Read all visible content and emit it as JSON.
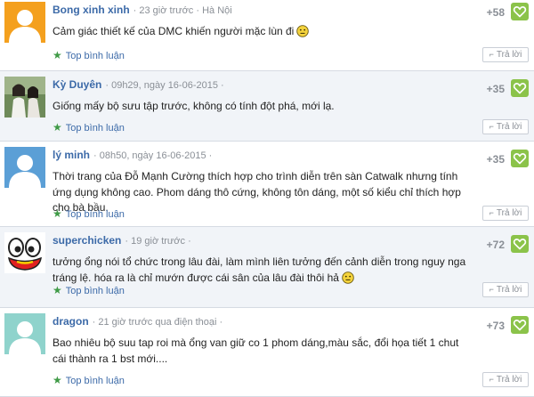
{
  "comments": [
    {
      "user": "Bong xinh xinh",
      "time": "· 23 giờ trước · Hà Nội",
      "text": "Cảm giác thiết kế của DMC khiến người mặc lùn đi",
      "emoticon": "neutral-face-icon",
      "score": "+58",
      "top_label": "Top bình luận",
      "reply_label": "Trả lời",
      "avatar": "default-avatar-orange"
    },
    {
      "user": "Kỳ Duyên",
      "time": "· 09h29, ngày 16-06-2015 ·",
      "text": "Giống mấy bộ sưu tập trước, không có tính đột phá, mới lạ.",
      "score": "+35",
      "top_label": "Top bình luận",
      "reply_label": "Trả lời",
      "avatar": "photo-avatar"
    },
    {
      "user": "lý minh",
      "time": "· 08h50, ngày 16-06-2015 ·",
      "text": "Thời trang của Đỗ Mạnh Cường thích hợp cho trình diễn trên sàn Catwalk nhưng tính ứng dụng không cao. Phom dáng thô cứng, không tôn dáng, một số kiểu chỉ thích hợp cho bà bầu.",
      "score": "+35",
      "top_label": "Top bình luận",
      "reply_label": "Trả lời",
      "avatar": "default-avatar-blue"
    },
    {
      "user": "superchicken",
      "time": "· 19 giờ trước ·",
      "text": "tưởng ổng nói tổ chức trong lâu đài, làm mình liên tưởng đến cảnh diễn trong nguy nga tráng lệ. hóa ra là chỉ mướn được cái sân của lâu đài thôi hả",
      "emoticon": "neutral-face-icon",
      "score": "+72",
      "top_label": "Top bình luận",
      "reply_label": "Trả lời",
      "avatar": "cartoon-eyes-avatar"
    },
    {
      "user": "dragon",
      "time": "· 21 giờ trước qua điện thoại ·",
      "text": "Bao nhiêu bộ suu tap roi mà ổng van giữ co 1 phom dáng,màu sắc, đổi họa tiết 1 chut cái thành ra 1 bst mới....",
      "score": "+73",
      "top_label": "Top bình luận",
      "reply_label": "Trả lời",
      "avatar": "default-avatar-teal"
    }
  ],
  "colors": {
    "username": "#3c6aa8",
    "star": "#3f9a46",
    "like_button": "#8bc34a",
    "meta": "#8a8f96",
    "alt_row_bg": "#f1f4f8"
  }
}
